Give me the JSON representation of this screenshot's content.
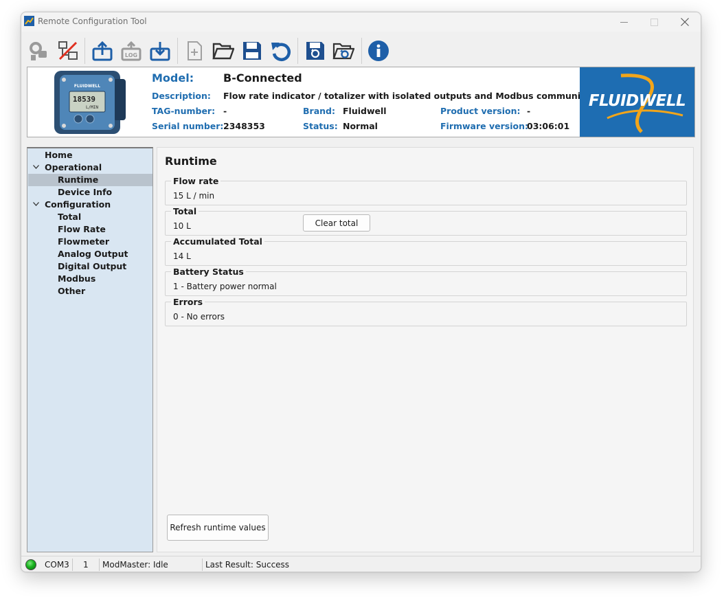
{
  "window": {
    "title": "Remote Configuration Tool"
  },
  "toolbar": {
    "buttons": [
      {
        "name": "connect-icon"
      },
      {
        "name": "disconnect-icon"
      },
      {
        "name": "upload-icon"
      },
      {
        "name": "log-icon"
      },
      {
        "name": "download-icon"
      },
      {
        "name": "new-file-icon"
      },
      {
        "name": "open-folder-icon"
      },
      {
        "name": "save-icon"
      },
      {
        "name": "undo-icon"
      },
      {
        "name": "save-device-icon"
      },
      {
        "name": "open-device-icon"
      },
      {
        "name": "info-icon"
      }
    ]
  },
  "device": {
    "display_value": "18539",
    "display_unit": "L/MIN",
    "model_label": "Model:",
    "model": "B-Connected",
    "description_label": "Description:",
    "description": "Flow rate indicator / totalizer with isolated outputs and Modbus communication",
    "tag_label": "TAG-number:",
    "tag": "-",
    "serial_label": "Serial number:",
    "serial": "2348353",
    "brand_label": "Brand:",
    "brand": "Fluidwell",
    "status_label": "Status:",
    "status": "Normal",
    "product_version_label": "Product version:",
    "product_version": "-",
    "firmware_version_label": "Firmware version:",
    "firmware_version": "03:06:01",
    "logo_text": "FLUIDWELL",
    "logo_color": "#1e6db2"
  },
  "tree": {
    "home": "Home",
    "operational": "Operational",
    "runtime": "Runtime",
    "device_info": "Device Info",
    "configuration": "Configuration",
    "total": "Total",
    "flow_rate": "Flow Rate",
    "flowmeter": "Flowmeter",
    "analog_output": "Analog Output",
    "digital_output": "Digital Output",
    "modbus": "Modbus",
    "other": "Other",
    "selected": "Runtime"
  },
  "runtime": {
    "title": "Runtime",
    "flow_rate_title": "Flow rate",
    "flow_rate_value": "15 L / min",
    "total_title": "Total",
    "total_value": "10 L",
    "clear_total_label": "Clear total",
    "accum_title": "Accumulated Total",
    "accum_value": "14 L",
    "battery_title": "Battery Status",
    "battery_value": "1 - Battery power normal",
    "errors_title": "Errors",
    "errors_value": "0 - No errors",
    "refresh_label": "Refresh runtime values"
  },
  "statusbar": {
    "port": "COM3",
    "address": "1",
    "modmaster": "ModMaster: Idle",
    "last_result": "Last Result: Success",
    "led_color": "#19b31f"
  }
}
